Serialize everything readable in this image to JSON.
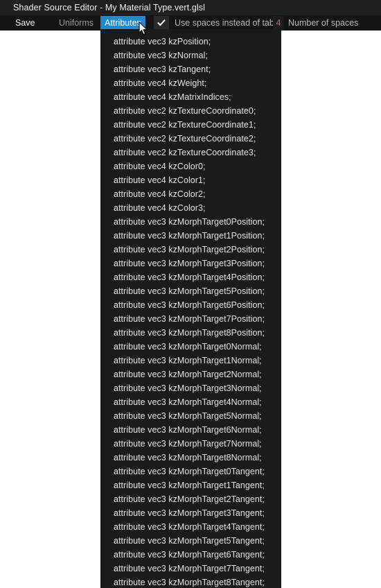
{
  "window": {
    "title": "Shader Source Editor - My Material Type.vert.glsl"
  },
  "toolbar": {
    "save_label": "Save",
    "uniforms_label": "Uniforms",
    "attributes_label": "Attributes",
    "use_spaces_label": "Use spaces instead of tabs",
    "use_spaces_checked": true,
    "check_glyph": "check-icon",
    "number_of_spaces_value": "4",
    "number_of_spaces_label": "Number of spaces",
    "accent_color": "#1f8ad2",
    "number_value_color": "#c96a5e"
  },
  "attributes_menu": {
    "open": true,
    "items": [
      "attribute vec3 kzPosition;",
      "attribute vec3 kzNormal;",
      "attribute vec3 kzTangent;",
      "attribute vec4 kzWeight;",
      "attribute vec4 kzMatrixIndices;",
      "attribute vec2 kzTextureCoordinate0;",
      "attribute vec2 kzTextureCoordinate1;",
      "attribute vec2 kzTextureCoordinate2;",
      "attribute vec2 kzTextureCoordinate3;",
      "attribute vec4 kzColor0;",
      "attribute vec4 kzColor1;",
      "attribute vec4 kzColor2;",
      "attribute vec4 kzColor3;",
      "attribute vec3 kzMorphTarget0Position;",
      "attribute vec3 kzMorphTarget1Position;",
      "attribute vec3 kzMorphTarget2Position;",
      "attribute vec3 kzMorphTarget3Position;",
      "attribute vec3 kzMorphTarget4Position;",
      "attribute vec3 kzMorphTarget5Position;",
      "attribute vec3 kzMorphTarget6Position;",
      "attribute vec3 kzMorphTarget7Position;",
      "attribute vec3 kzMorphTarget8Position;",
      "attribute vec3 kzMorphTarget0Normal;",
      "attribute vec3 kzMorphTarget1Normal;",
      "attribute vec3 kzMorphTarget2Normal;",
      "attribute vec3 kzMorphTarget3Normal;",
      "attribute vec3 kzMorphTarget4Normal;",
      "attribute vec3 kzMorphTarget5Normal;",
      "attribute vec3 kzMorphTarget6Normal;",
      "attribute vec3 kzMorphTarget7Normal;",
      "attribute vec3 kzMorphTarget8Normal;",
      "attribute vec3 kzMorphTarget0Tangent;",
      "attribute vec3 kzMorphTarget1Tangent;",
      "attribute vec3 kzMorphTarget2Tangent;",
      "attribute vec3 kzMorphTarget3Tangent;",
      "attribute vec3 kzMorphTarget4Tangent;",
      "attribute vec3 kzMorphTarget5Tangent;",
      "attribute vec3 kzMorphTarget6Tangent;",
      "attribute vec3 kzMorphTarget7Tangent;",
      "attribute vec3 kzMorphTarget8Tangent;"
    ]
  },
  "cursor": {
    "icon": "arrow-pointer-icon"
  }
}
